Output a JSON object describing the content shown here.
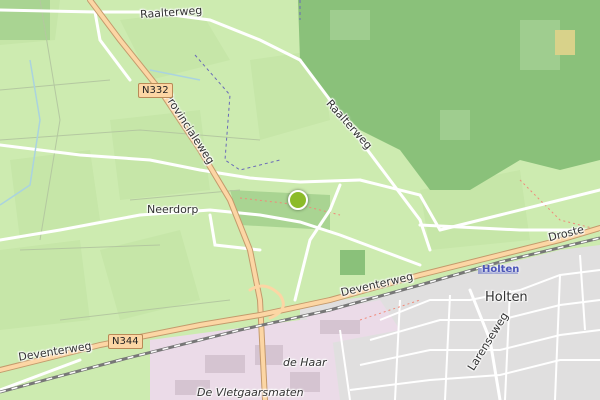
{
  "map": {
    "type": "street-map",
    "labels": {
      "raalterweg_north": "Raalterweg",
      "raalterweg_east": "Raalterweg",
      "provincialeweg": "Provincialeweg",
      "n332": "N332",
      "neerdorp": "Neerdorp",
      "deventerweg_center": "Deventerweg",
      "deventerweg_west": "Deventerweg",
      "n344": "N344",
      "holten_station": "Holten",
      "holten_place": "Holten",
      "larenseweg": "Larenseweg",
      "de_haar": "de Haar",
      "vletgaarsmaten": "De Vletgaarsmaten",
      "droste": "Droste"
    },
    "marker": {
      "color": "#8cbb2a"
    },
    "colors": {
      "farmland": "#cdebb0",
      "meadow": "#bde7a0",
      "forest": "#8ac17a",
      "residential": "#e0dfdf",
      "industrial": "#ebdbe8",
      "primary_road": "#fcd6a4",
      "railway": "#777777"
    }
  }
}
